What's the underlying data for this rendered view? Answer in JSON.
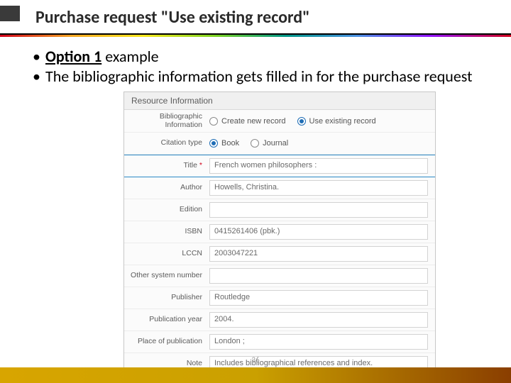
{
  "title": "Purchase request \"Use existing record\"",
  "bullets": {
    "b1_bold": "Option 1",
    "b1_rest": " example",
    "b2": "The bibliographic information gets filled in for the purchase request"
  },
  "page_number": "36",
  "form": {
    "panel_header": "Resource Information",
    "labels": {
      "biblio": "Bibliographic Information",
      "citation_type": "Citation type",
      "title": "Title",
      "author": "Author",
      "edition": "Edition",
      "isbn": "ISBN",
      "lccn": "LCCN",
      "other_sys": "Other system number",
      "publisher": "Publisher",
      "pub_year": "Publication year",
      "place": "Place of publication",
      "note": "Note"
    },
    "radios": {
      "create_new": "Create new record",
      "use_existing": "Use existing record",
      "book": "Book",
      "journal": "Journal"
    },
    "values": {
      "title": "French women philosophers :",
      "author": "Howells, Christina.",
      "edition": "",
      "isbn": "0415261406 (pbk.)",
      "lccn": "2003047221",
      "other_sys": "",
      "publisher": "Routledge",
      "pub_year": "2004.",
      "place": "London ;",
      "note": "Includes bibliographical references and index."
    },
    "required_marker": "*"
  }
}
